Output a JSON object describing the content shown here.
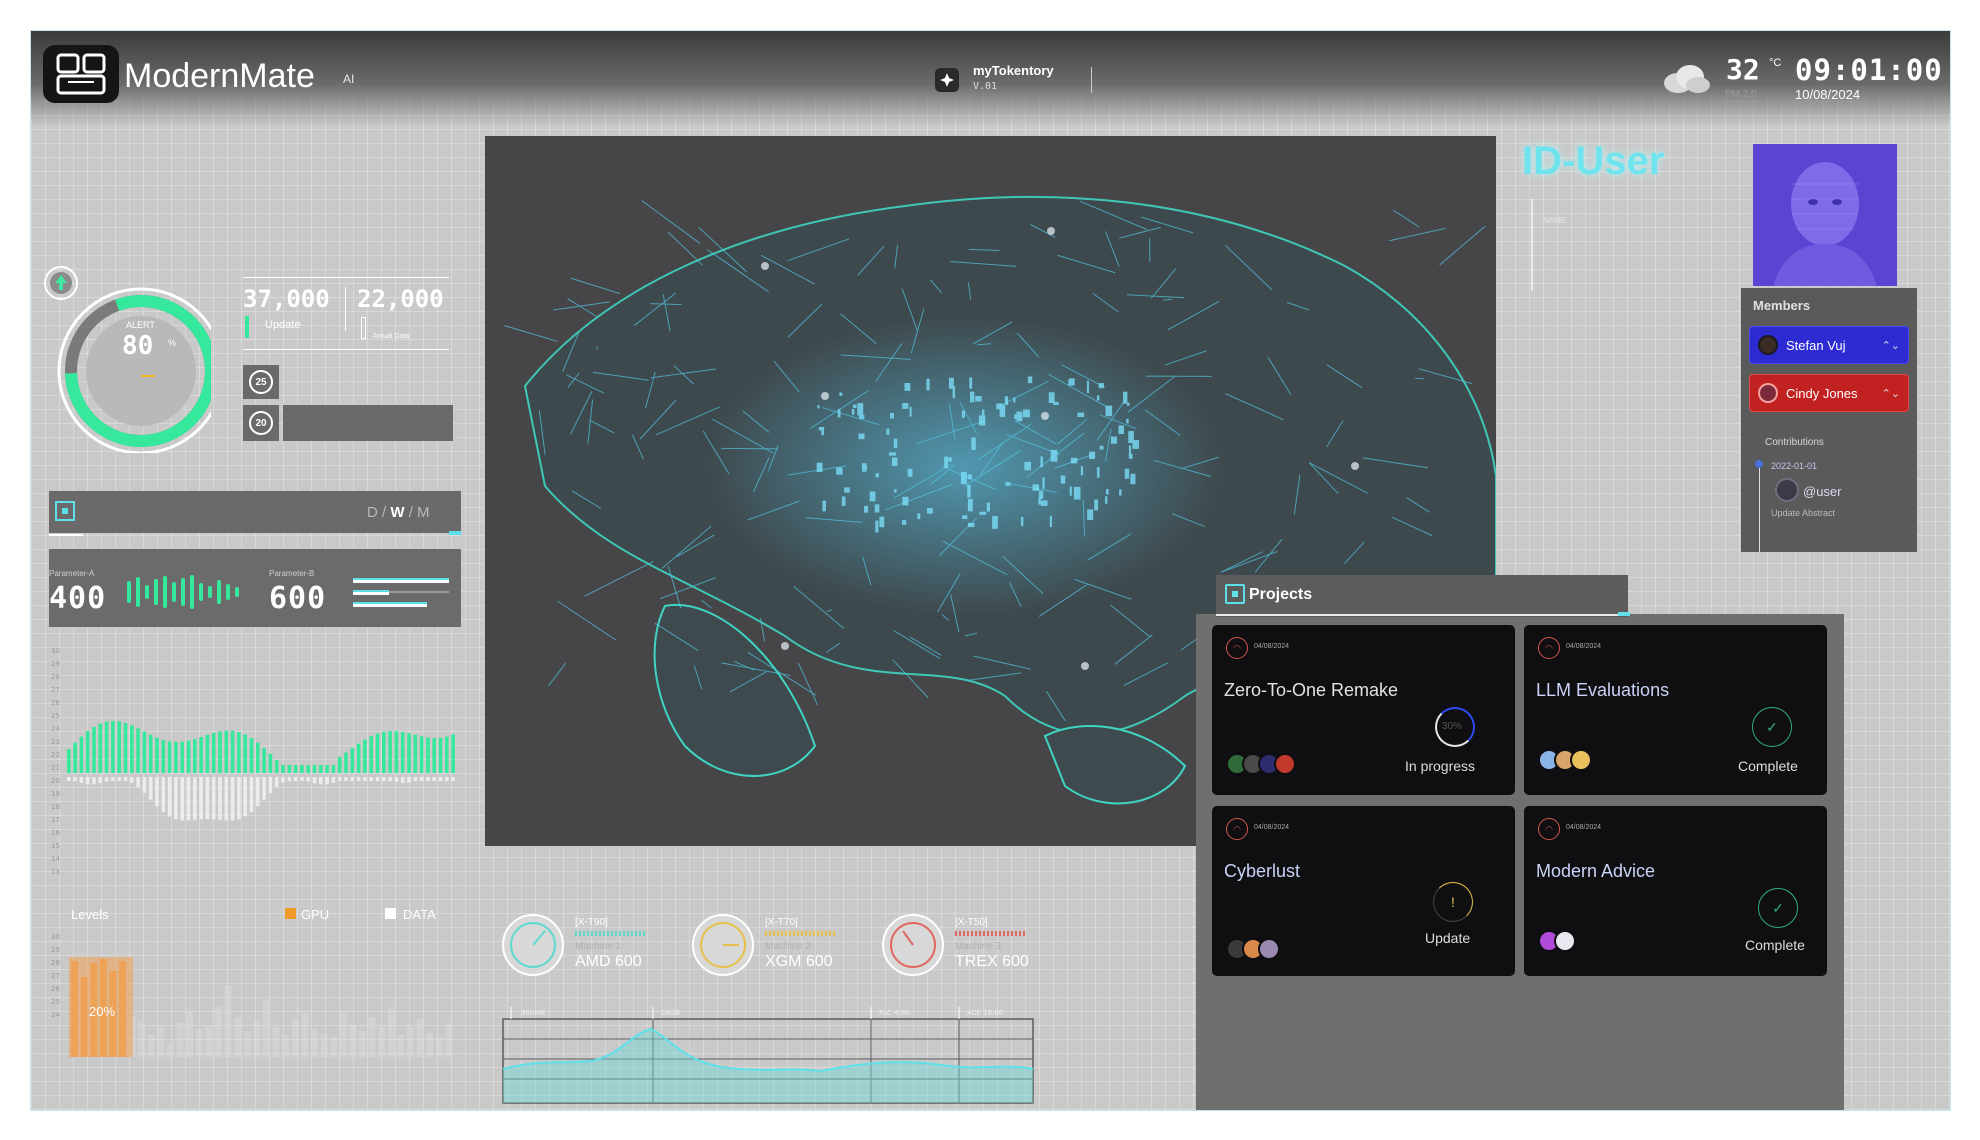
{
  "header": {
    "brand": "ModernMate",
    "brand_tag": "AI",
    "center_title": "myTokentory",
    "center_version": "V.01",
    "temperature": "32",
    "temperature_unit": "°C",
    "pm": "PM 2.0",
    "time": "09:01:00",
    "date": "10/08/2024",
    "icons": [
      "grid-logo-icon",
      "diamond-star-icon",
      "cloud-weather-icon"
    ]
  },
  "left": {
    "gauge": {
      "alert_label": "ALERT",
      "alert_value": "80",
      "unit": "%",
      "level": 0.8
    },
    "stat_update": {
      "value": "37,000",
      "label": "Update"
    },
    "stat_actual": {
      "value": "22,000",
      "label": "Actual Data"
    },
    "badges": [
      "25",
      "20"
    ],
    "range_toggle": {
      "d": "D",
      "w": "W",
      "m": "M",
      "sep": "/",
      "selected": "W"
    },
    "param_a": {
      "label": "Parameter-A",
      "value": "400"
    },
    "param_b": {
      "label": "Parameter-B",
      "value": "600"
    },
    "chart_ticks": [
      "30",
      "29",
      "28",
      "27",
      "26",
      "25",
      "24",
      "23",
      "22",
      "21",
      "20",
      "19",
      "18",
      "17",
      "16",
      "15",
      "14",
      "13"
    ],
    "levels": {
      "title": "Levels",
      "legend_gpu": "GPU",
      "legend_data": "DATA",
      "percent": "20%",
      "ticks": [
        "30",
        "29",
        "28",
        "27",
        "26",
        "25",
        "24"
      ]
    }
  },
  "user": {
    "title": "ID-User",
    "name_label": "NAME",
    "members_title": "Members",
    "members": [
      {
        "name": "Stefan Vuj",
        "color": "#2d2bd1"
      },
      {
        "name": "Cindy Jones",
        "color": "#c12121"
      }
    ],
    "contributions_title": "Contributions",
    "contribution_date": "2022-01-01",
    "contribution_user": "@user",
    "contribution_abstract": "Update Abstract"
  },
  "projects": {
    "title": "Projects",
    "cards": [
      {
        "date": "04/08/2024",
        "title": "Zero-To-One Remake",
        "status": "In progress",
        "progress": "30%",
        "title_color": "#e2e2e2"
      },
      {
        "date": "04/08/2024",
        "title": "LLM Evaluations",
        "status": "Complete",
        "title_color": "#c9d3f7"
      },
      {
        "date": "04/08/2024",
        "title": "Cyberlust",
        "status": "Update",
        "title_color": "#c9d3f7"
      },
      {
        "date": "04/08/2024",
        "title": "Modern Advice",
        "status": "Complete",
        "title_color": "#c9d3f7"
      }
    ]
  },
  "machines": [
    {
      "tag": "[X-T90]",
      "sub": "Machine 1",
      "name": "AMD 600",
      "color": "#5fd9cc"
    },
    {
      "tag": "[X-T70]",
      "sub": "Machine 2",
      "name": "XGM 600",
      "color": "#e7c14b"
    },
    {
      "tag": "[X-T50]",
      "sub": "Machine 3",
      "name": "TREX 600",
      "color": "#e06a63"
    }
  ],
  "timeline": {
    "labels": [
      "300MB",
      "28GB",
      "FLC 4.90",
      "ACE 18.00"
    ]
  }
}
